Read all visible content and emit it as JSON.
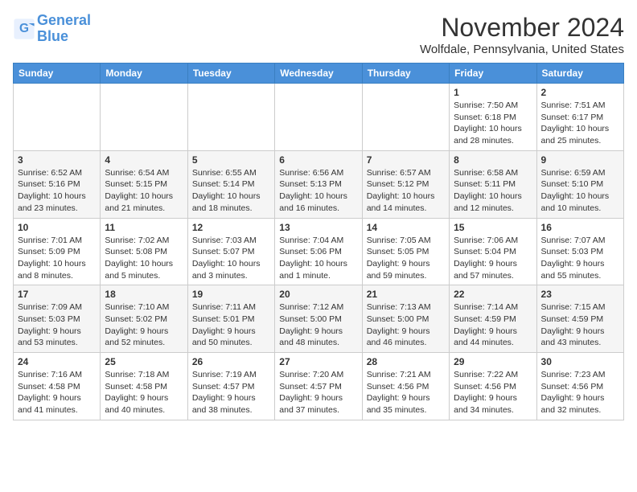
{
  "header": {
    "logo_line1": "General",
    "logo_line2": "Blue",
    "month_title": "November 2024",
    "location": "Wolfdale, Pennsylvania, United States"
  },
  "weekdays": [
    "Sunday",
    "Monday",
    "Tuesday",
    "Wednesday",
    "Thursday",
    "Friday",
    "Saturday"
  ],
  "weeks": [
    [
      {
        "day": "",
        "info": ""
      },
      {
        "day": "",
        "info": ""
      },
      {
        "day": "",
        "info": ""
      },
      {
        "day": "",
        "info": ""
      },
      {
        "day": "",
        "info": ""
      },
      {
        "day": "1",
        "info": "Sunrise: 7:50 AM\nSunset: 6:18 PM\nDaylight: 10 hours and 28 minutes."
      },
      {
        "day": "2",
        "info": "Sunrise: 7:51 AM\nSunset: 6:17 PM\nDaylight: 10 hours and 25 minutes."
      }
    ],
    [
      {
        "day": "3",
        "info": "Sunrise: 6:52 AM\nSunset: 5:16 PM\nDaylight: 10 hours and 23 minutes."
      },
      {
        "day": "4",
        "info": "Sunrise: 6:54 AM\nSunset: 5:15 PM\nDaylight: 10 hours and 21 minutes."
      },
      {
        "day": "5",
        "info": "Sunrise: 6:55 AM\nSunset: 5:14 PM\nDaylight: 10 hours and 18 minutes."
      },
      {
        "day": "6",
        "info": "Sunrise: 6:56 AM\nSunset: 5:13 PM\nDaylight: 10 hours and 16 minutes."
      },
      {
        "day": "7",
        "info": "Sunrise: 6:57 AM\nSunset: 5:12 PM\nDaylight: 10 hours and 14 minutes."
      },
      {
        "day": "8",
        "info": "Sunrise: 6:58 AM\nSunset: 5:11 PM\nDaylight: 10 hours and 12 minutes."
      },
      {
        "day": "9",
        "info": "Sunrise: 6:59 AM\nSunset: 5:10 PM\nDaylight: 10 hours and 10 minutes."
      }
    ],
    [
      {
        "day": "10",
        "info": "Sunrise: 7:01 AM\nSunset: 5:09 PM\nDaylight: 10 hours and 8 minutes."
      },
      {
        "day": "11",
        "info": "Sunrise: 7:02 AM\nSunset: 5:08 PM\nDaylight: 10 hours and 5 minutes."
      },
      {
        "day": "12",
        "info": "Sunrise: 7:03 AM\nSunset: 5:07 PM\nDaylight: 10 hours and 3 minutes."
      },
      {
        "day": "13",
        "info": "Sunrise: 7:04 AM\nSunset: 5:06 PM\nDaylight: 10 hours and 1 minute."
      },
      {
        "day": "14",
        "info": "Sunrise: 7:05 AM\nSunset: 5:05 PM\nDaylight: 9 hours and 59 minutes."
      },
      {
        "day": "15",
        "info": "Sunrise: 7:06 AM\nSunset: 5:04 PM\nDaylight: 9 hours and 57 minutes."
      },
      {
        "day": "16",
        "info": "Sunrise: 7:07 AM\nSunset: 5:03 PM\nDaylight: 9 hours and 55 minutes."
      }
    ],
    [
      {
        "day": "17",
        "info": "Sunrise: 7:09 AM\nSunset: 5:03 PM\nDaylight: 9 hours and 53 minutes."
      },
      {
        "day": "18",
        "info": "Sunrise: 7:10 AM\nSunset: 5:02 PM\nDaylight: 9 hours and 52 minutes."
      },
      {
        "day": "19",
        "info": "Sunrise: 7:11 AM\nSunset: 5:01 PM\nDaylight: 9 hours and 50 minutes."
      },
      {
        "day": "20",
        "info": "Sunrise: 7:12 AM\nSunset: 5:00 PM\nDaylight: 9 hours and 48 minutes."
      },
      {
        "day": "21",
        "info": "Sunrise: 7:13 AM\nSunset: 5:00 PM\nDaylight: 9 hours and 46 minutes."
      },
      {
        "day": "22",
        "info": "Sunrise: 7:14 AM\nSunset: 4:59 PM\nDaylight: 9 hours and 44 minutes."
      },
      {
        "day": "23",
        "info": "Sunrise: 7:15 AM\nSunset: 4:59 PM\nDaylight: 9 hours and 43 minutes."
      }
    ],
    [
      {
        "day": "24",
        "info": "Sunrise: 7:16 AM\nSunset: 4:58 PM\nDaylight: 9 hours and 41 minutes."
      },
      {
        "day": "25",
        "info": "Sunrise: 7:18 AM\nSunset: 4:58 PM\nDaylight: 9 hours and 40 minutes."
      },
      {
        "day": "26",
        "info": "Sunrise: 7:19 AM\nSunset: 4:57 PM\nDaylight: 9 hours and 38 minutes."
      },
      {
        "day": "27",
        "info": "Sunrise: 7:20 AM\nSunset: 4:57 PM\nDaylight: 9 hours and 37 minutes."
      },
      {
        "day": "28",
        "info": "Sunrise: 7:21 AM\nSunset: 4:56 PM\nDaylight: 9 hours and 35 minutes."
      },
      {
        "day": "29",
        "info": "Sunrise: 7:22 AM\nSunset: 4:56 PM\nDaylight: 9 hours and 34 minutes."
      },
      {
        "day": "30",
        "info": "Sunrise: 7:23 AM\nSunset: 4:56 PM\nDaylight: 9 hours and 32 minutes."
      }
    ]
  ]
}
